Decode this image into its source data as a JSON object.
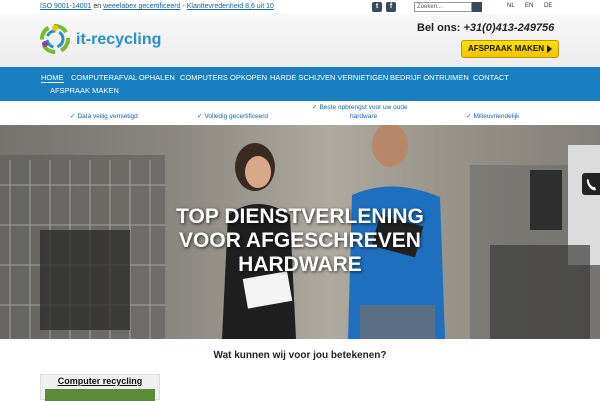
{
  "topbar": {
    "link_iso": "ISO 9001-14001",
    "sep1": " en ",
    "link_weee": "weeelabex gecertificeerd",
    "sep2": " - ",
    "link_rating": "Klanttevredenheid 8,6 uit 10",
    "search_placeholder": "Zoeken...",
    "languages": [
      "NL",
      "EN",
      "DE"
    ]
  },
  "header": {
    "logo_text": "it-recycling",
    "phone_label": "Bel ons:",
    "phone_number": "+31(0)413-249756",
    "cta_label": "AFSPRAAK MAKEN"
  },
  "nav": {
    "items": [
      "HOME",
      "COMPUTERAFVAL OPHALEN",
      "COMPUTERS OPKOPEN",
      "HARDE SCHIJVEN VERNIETIGEN",
      "BEDRIJF ONTRUIMEN",
      "CONTACT",
      "AFSPRAAK MAKEN"
    ]
  },
  "usps": [
    "Data veilig vernietigd",
    "Volledig gecertificeerd",
    "Beste opbrengst voor uw oude",
    "hardware",
    "Milieuvriendelijk"
  ],
  "hero": {
    "line1": "TOP DIENSTVERLENING",
    "line2": "VOOR AFGESCHREVEN",
    "line3": "HARDWARE"
  },
  "content": {
    "section_title": "Wat kunnen wij voor jou betekenen?",
    "card_title": "Computer recycling"
  },
  "colors": {
    "nav_blue": "#1a7fc1",
    "cta_yellow": "#f2c400",
    "link_blue": "#1a5fa8"
  }
}
